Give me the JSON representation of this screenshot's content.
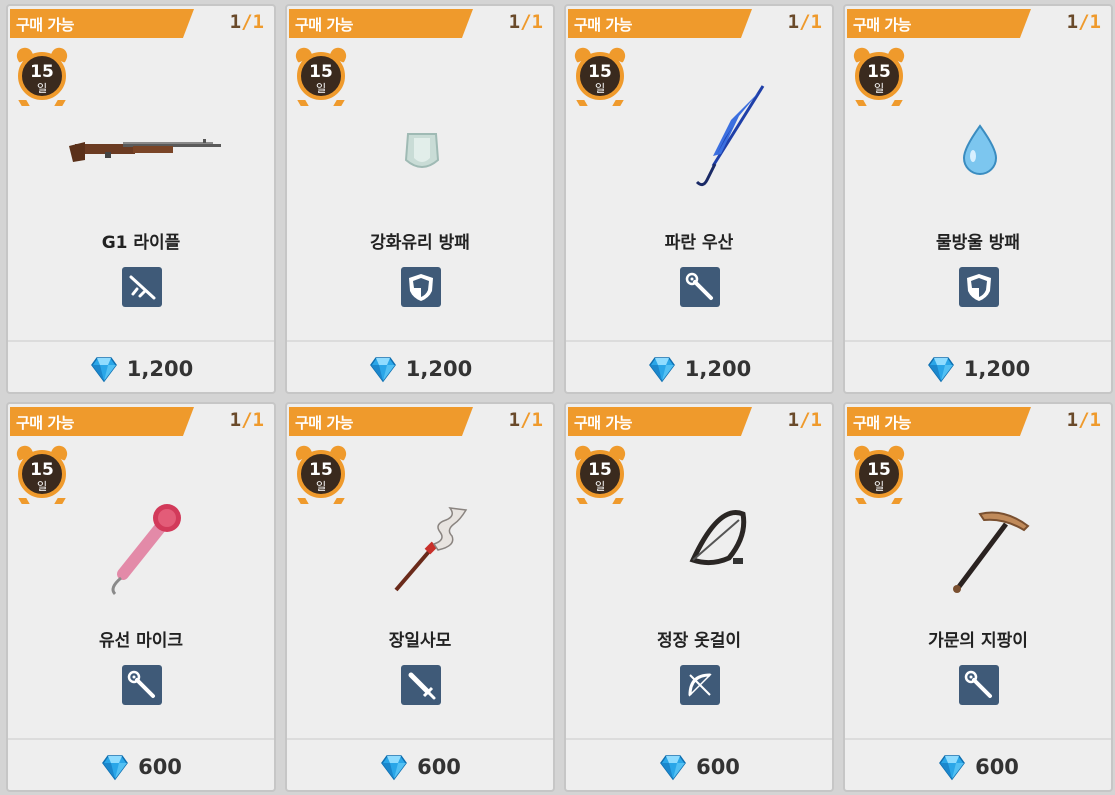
{
  "shop": {
    "status_label": "구매 가능",
    "currency_icon": "diamond-gem-icon",
    "colors": {
      "banner": "#ef9a2c",
      "badge": "#3f5a78",
      "gem": "#2aa6e8"
    },
    "items": [
      {
        "status": "구매 가능",
        "stock_current": "1",
        "stock_sep": "/",
        "stock_max": "1",
        "days": "15",
        "days_unit": "일",
        "name": "G1 라이플",
        "type_icon": "rifle-icon",
        "price": "1,200",
        "art": "rifle"
      },
      {
        "status": "구매 가능",
        "stock_current": "1",
        "stock_sep": "/",
        "stock_max": "1",
        "days": "15",
        "days_unit": "일",
        "name": "강화유리 방패",
        "type_icon": "shield-icon",
        "price": "1,200",
        "art": "glass-shield"
      },
      {
        "status": "구매 가능",
        "stock_current": "1",
        "stock_sep": "/",
        "stock_max": "1",
        "days": "15",
        "days_unit": "일",
        "name": "파란 우산",
        "type_icon": "wand-icon",
        "price": "1,200",
        "art": "umbrella"
      },
      {
        "status": "구매 가능",
        "stock_current": "1",
        "stock_sep": "/",
        "stock_max": "1",
        "days": "15",
        "days_unit": "일",
        "name": "물방울 방패",
        "type_icon": "shield-icon",
        "price": "1,200",
        "art": "droplet"
      },
      {
        "status": "구매 가능",
        "stock_current": "1",
        "stock_sep": "/",
        "stock_max": "1",
        "days": "15",
        "days_unit": "일",
        "name": "유선 마이크",
        "type_icon": "wand-icon",
        "price": "600",
        "art": "microphone"
      },
      {
        "status": "구매 가능",
        "stock_current": "1",
        "stock_sep": "/",
        "stock_max": "1",
        "days": "15",
        "days_unit": "일",
        "name": "장일사모",
        "type_icon": "sword-icon",
        "price": "600",
        "art": "serpent-spear"
      },
      {
        "status": "구매 가능",
        "stock_current": "1",
        "stock_sep": "/",
        "stock_max": "1",
        "days": "15",
        "days_unit": "일",
        "name": "정장 옷걸이",
        "type_icon": "bow-icon",
        "price": "600",
        "art": "hanger-bow"
      },
      {
        "status": "구매 가능",
        "stock_current": "1",
        "stock_sep": "/",
        "stock_max": "1",
        "days": "15",
        "days_unit": "일",
        "name": "가문의 지팡이",
        "type_icon": "wand-icon",
        "price": "600",
        "art": "pickaxe"
      }
    ]
  }
}
